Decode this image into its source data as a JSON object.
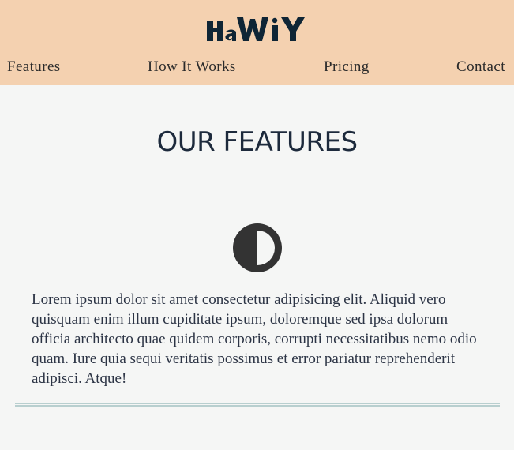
{
  "header": {
    "logo_text": "HaWiY",
    "background": "#f4d1b0"
  },
  "nav": {
    "items": [
      {
        "label": "Features"
      },
      {
        "label": "How It Works"
      },
      {
        "label": "Pricing"
      },
      {
        "label": "Contact"
      }
    ]
  },
  "main": {
    "title": "OUR FEATURES",
    "feature": {
      "icon": "adjust-contrast-icon",
      "description": "Lorem ipsum dolor sit amet consectetur adipisicing elit. Aliquid vero quisquam enim illum cupiditate ipsum, doloremque sed ipsa dolorum officia architecto quae quidem corporis, corrupti necessitatibus nemo odio quam. Iure quia sequi veritatis possimus et error pariatur reprehenderit adipisci. Atque!"
    }
  },
  "colors": {
    "page_background": "#f5f6f5",
    "title_text": "#1d2a3c",
    "divider": "#b8cfcf"
  }
}
